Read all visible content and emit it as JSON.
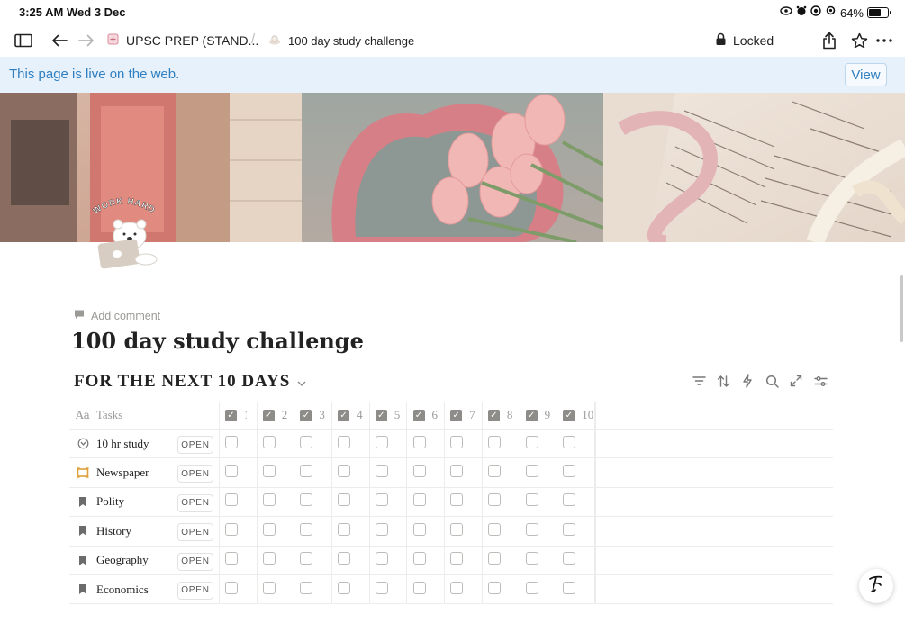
{
  "status_bar": {
    "time": "3:25 AM",
    "date": "Wed 3 Dec",
    "battery": "64%",
    "battery_level": 0.64
  },
  "nav": {
    "workspace_name": "UPSC PREP (STAND...",
    "breadcrumb_separator": "/",
    "page_name": "100 day study challenge",
    "locked_label": "Locked"
  },
  "banner": {
    "message": "This page is live on the web.",
    "view_label": "View"
  },
  "sticker": {
    "text": "WORK HARD"
  },
  "page": {
    "add_comment": "Add comment",
    "title": "100 day study challenge"
  },
  "database": {
    "view_title": "FOR THE NEXT 10 DAYS",
    "task_column": "Tasks",
    "day_columns": [
      "1",
      "2",
      "3",
      "4",
      "5",
      "6",
      "7",
      "8",
      "9",
      "10"
    ],
    "open_label": "OPEN",
    "rows": [
      {
        "name": "10 hr study",
        "icon": "target-icon"
      },
      {
        "name": "Newspaper",
        "icon": "newspaper-icon"
      },
      {
        "name": "Polity",
        "icon": "bookmark-icon"
      },
      {
        "name": "History",
        "icon": "bookmark-icon"
      },
      {
        "name": "Geography",
        "icon": "bookmark-icon"
      },
      {
        "name": "Economics",
        "icon": "bookmark-icon"
      }
    ],
    "checks": [
      [
        false,
        false,
        false,
        false,
        false,
        false,
        false,
        false,
        false,
        false
      ],
      [
        false,
        false,
        false,
        false,
        false,
        false,
        false,
        false,
        false,
        false
      ],
      [
        false,
        false,
        false,
        false,
        false,
        false,
        false,
        false,
        false,
        false
      ],
      [
        false,
        false,
        false,
        false,
        false,
        false,
        false,
        false,
        false,
        false
      ],
      [
        false,
        false,
        false,
        false,
        false,
        false,
        false,
        false,
        false,
        false
      ],
      [
        false,
        false,
        false,
        false,
        false,
        false,
        false,
        false,
        false,
        false
      ]
    ]
  },
  "colors": {
    "banner_bg": "#e6f1fb",
    "banner_text": "#2f7fc1",
    "newspaper_icon": "#e0a03a",
    "bookmark_icon": "#6b6b6b"
  }
}
